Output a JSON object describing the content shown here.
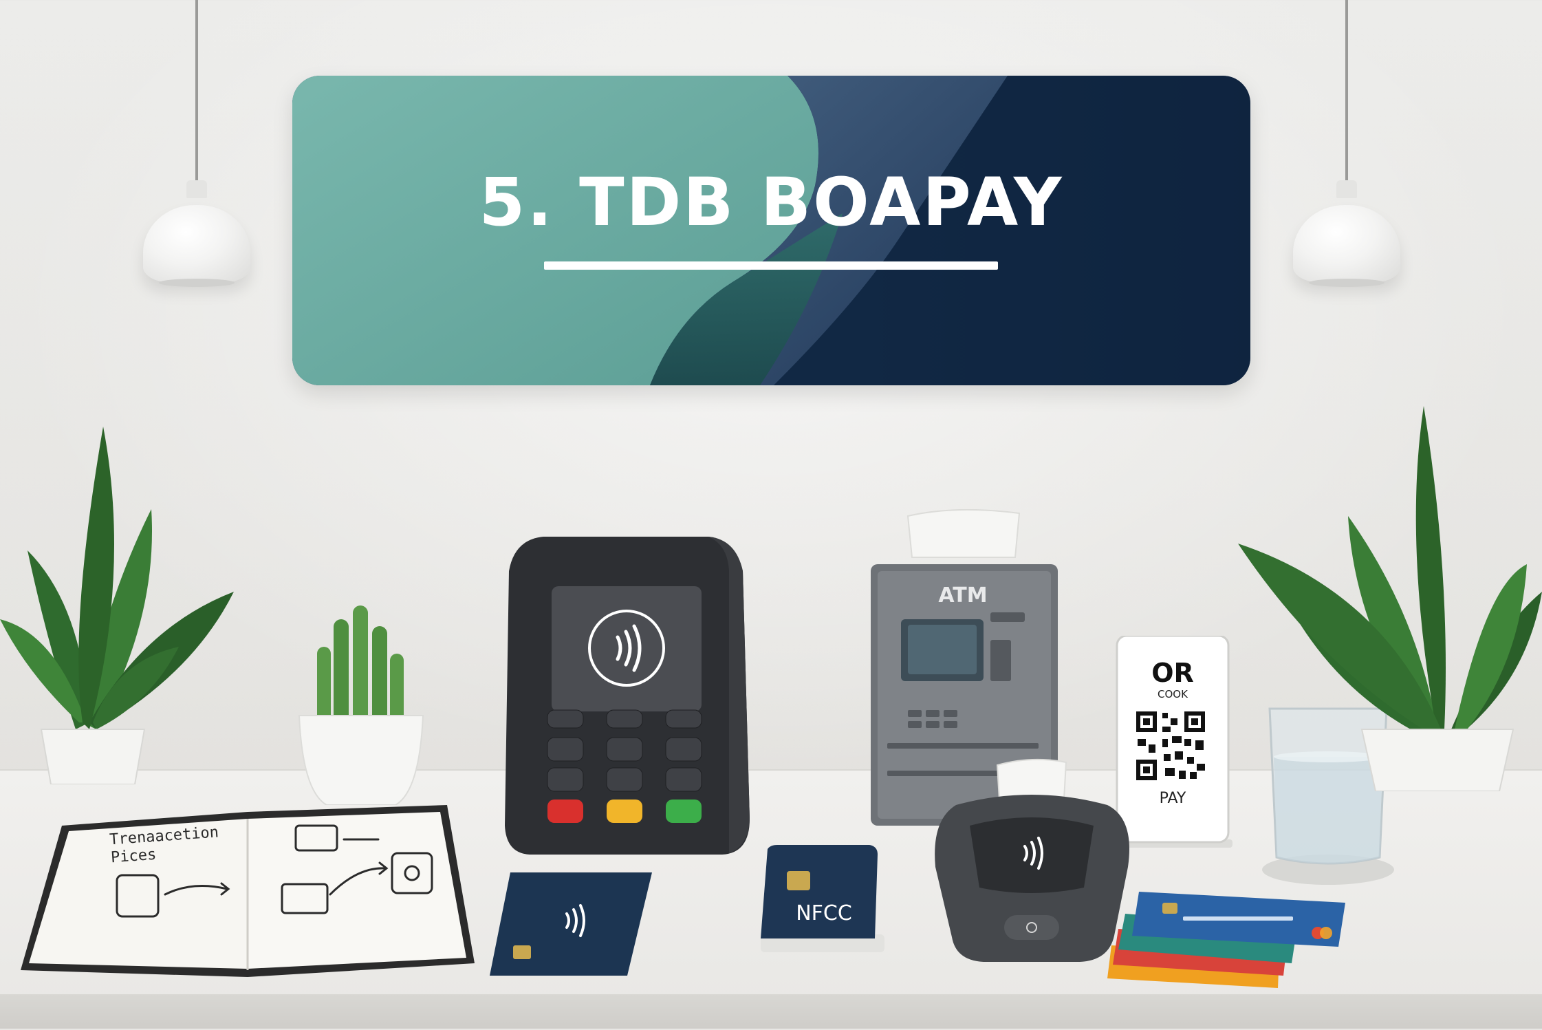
{
  "banner": {
    "title": "5. TDB BOAPAY",
    "colors": {
      "teal": "#6aaba0",
      "navy": "#0f2440",
      "slate": "#3e5877"
    }
  },
  "notebook": {
    "heading": "Trenaacetion\nPices"
  },
  "atm": {
    "label": "ATM"
  },
  "qr_stand": {
    "top_label": "OR",
    "sub_label": "COOK",
    "bottom_label": "PAY"
  },
  "nfc_card": {
    "label": "NFCC"
  },
  "cards": {
    "text": "— — — — — — —"
  },
  "icons": [
    "contactless-icon",
    "qr-code-icon",
    "chip-icon",
    "atm-keypad-icon"
  ]
}
